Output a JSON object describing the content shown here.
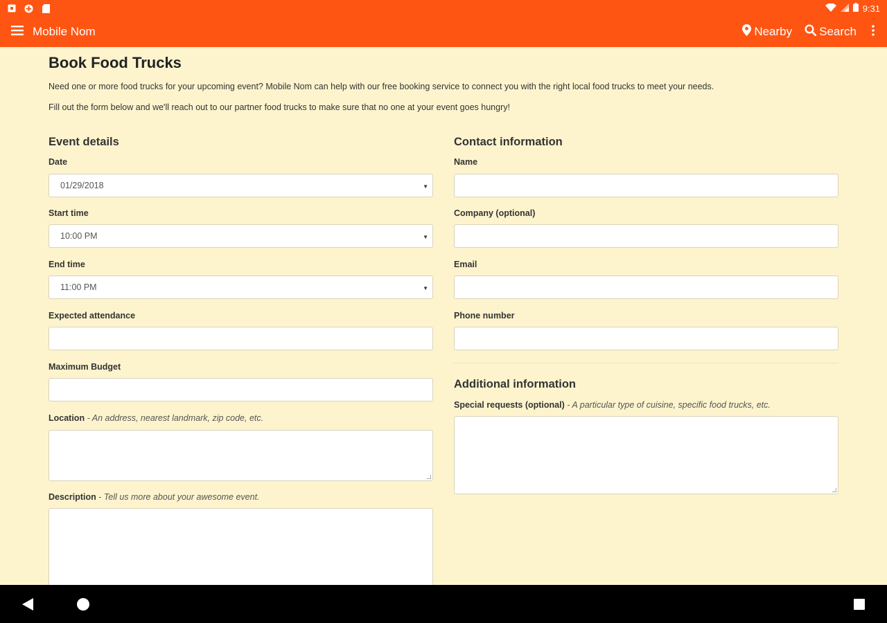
{
  "status_bar": {
    "time": "9:31",
    "icons": [
      "notification-box-icon",
      "notification-circle-icon",
      "sd-card-icon",
      "wifi-icon",
      "signal-icon",
      "battery-icon"
    ]
  },
  "app_bar": {
    "title": "Mobile Nom",
    "nearby_label": "Nearby",
    "search_label": "Search",
    "icons": [
      "menu-icon",
      "location-pin-icon",
      "search-icon",
      "more-vert-icon"
    ]
  },
  "page": {
    "title": "Book Food Trucks",
    "intro_1": "Need one or more food trucks for your upcoming event? Mobile Nom can help with our free booking service to connect you with the right local food trucks to meet your needs.",
    "intro_2": "Fill out the form below and we'll reach out to our partner food trucks to make sure that no one at your event goes hungry!"
  },
  "event_details": {
    "heading": "Event details",
    "date_label": "Date",
    "date_value": "01/29/2018",
    "start_label": "Start time",
    "start_value": "10:00 PM",
    "end_label": "End time",
    "end_value": "11:00 PM",
    "attendance_label": "Expected attendance",
    "budget_label": "Maximum Budget",
    "location_label": "Location",
    "location_hint": " - An address, nearest landmark, zip code, etc.",
    "description_label": "Description",
    "description_hint": " - Tell us more about your awesome event."
  },
  "contact": {
    "heading": "Contact information",
    "name_label": "Name",
    "company_label": "Company (optional)",
    "email_label": "Email",
    "phone_label": "Phone number"
  },
  "additional": {
    "heading": "Additional information",
    "special_label": "Special requests (optional)",
    "special_hint": " - A particular type of cuisine, specific food trucks, etc."
  },
  "colors": {
    "brand_orange": "#ff5512",
    "page_background": "#fdf4cd",
    "nav_bar": "#000000"
  }
}
